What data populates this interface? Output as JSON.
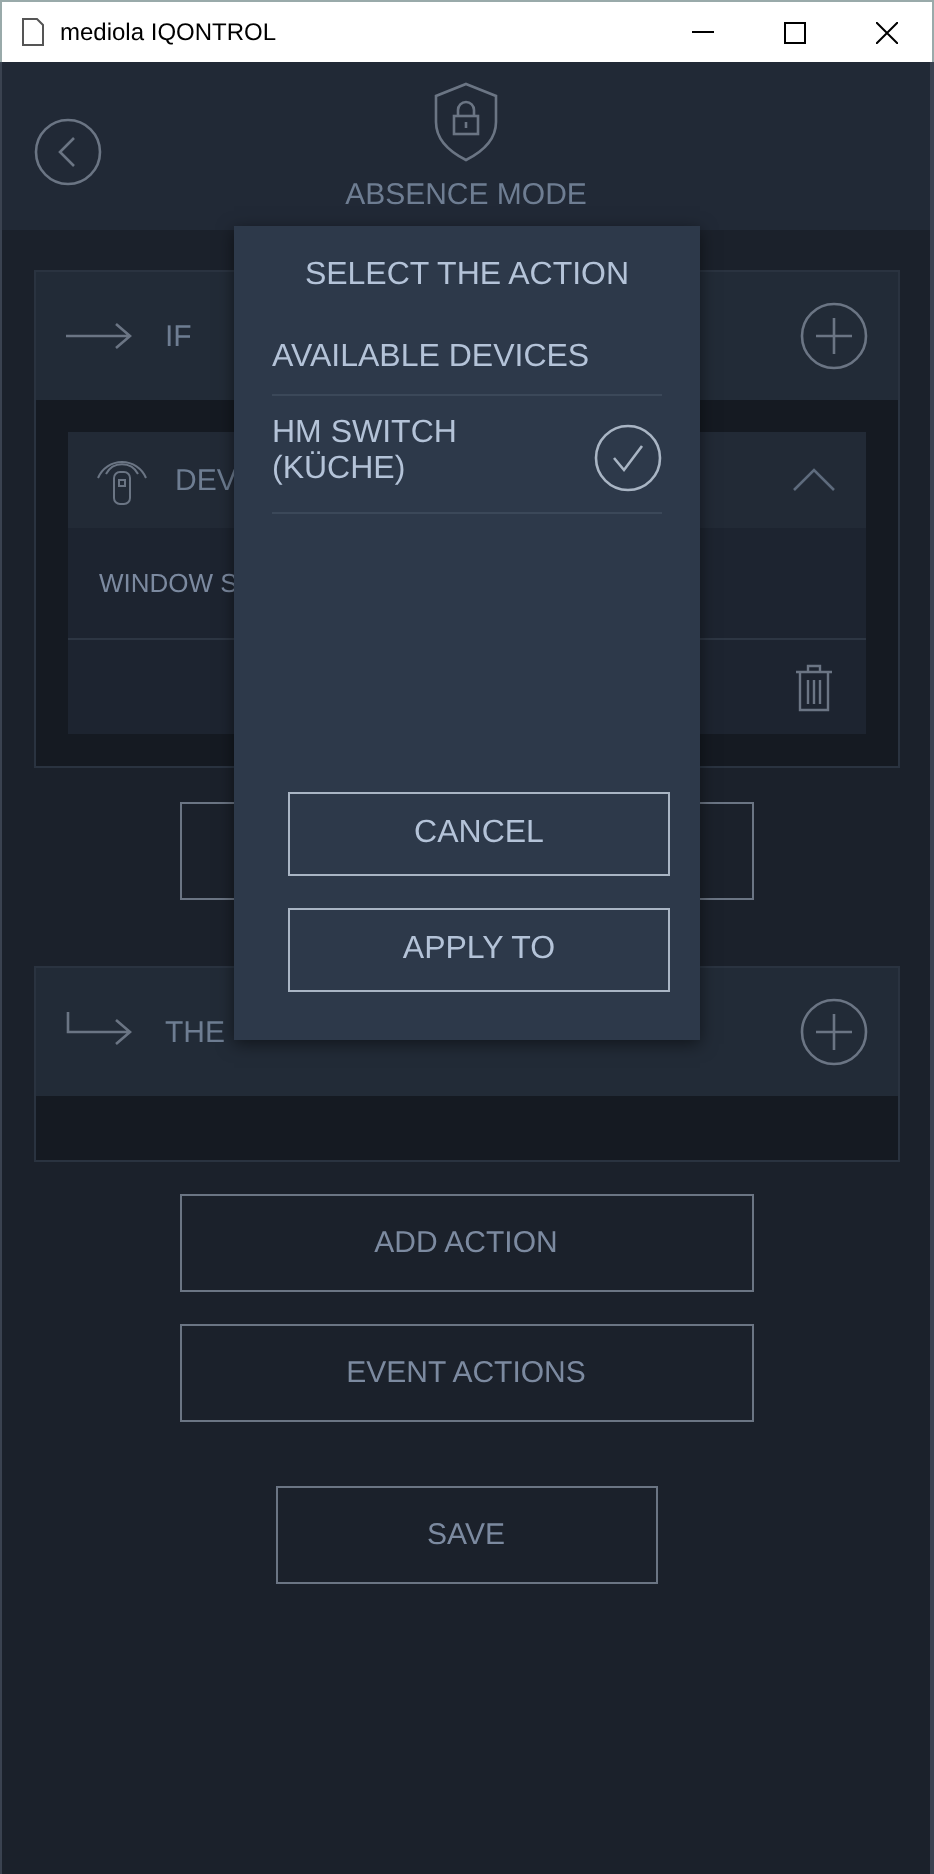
{
  "window": {
    "title": "mediola IQONTROL"
  },
  "header": {
    "title": "ABSENCE MODE"
  },
  "if_section": {
    "label": "IF",
    "device": {
      "name": "DEV",
      "expanded": true,
      "rows": [
        "WINDOW S"
      ]
    }
  },
  "then_section": {
    "label": "THE"
  },
  "buttons": [
    "ADD ACTION",
    "EVENT ACTIONS",
    "SAVE"
  ],
  "dialog": {
    "title": "SELECT THE ACTION",
    "subtitle": "AVAILABLE DEVICES",
    "devices": [
      {
        "name": "HM SWITCH (KÜCHE)",
        "selected": true
      }
    ],
    "buttons": [
      "CANCEL",
      "APPLY TO"
    ]
  }
}
